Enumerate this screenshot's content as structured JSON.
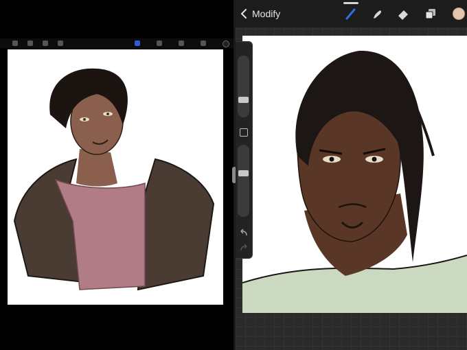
{
  "header": {
    "back_label": "Modify"
  },
  "toolbar": {
    "tools": [
      "brush-icon",
      "smudge-icon",
      "eraser-icon",
      "layers-icon"
    ],
    "active_tool": "brush-icon",
    "current_color": "#e7c6ae"
  },
  "left_toolbar": {
    "active_color": "#2f5bd6"
  },
  "colors": {
    "canvas_background": "#ffffff",
    "workspace_grid": "#2a2a2a",
    "shirt_left": "#b27c86",
    "jacket": "#4a3b33",
    "shirt_right": "#cbd9c0",
    "skin_left": "#8b5f4d",
    "skin_right": "#5a3626"
  }
}
